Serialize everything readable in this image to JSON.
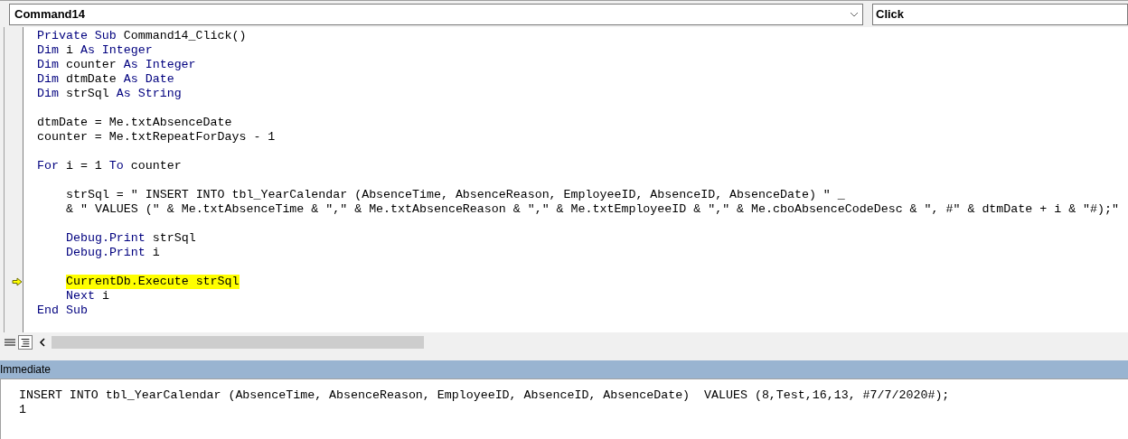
{
  "object_dropdown": {
    "value": "Command14"
  },
  "procedure_dropdown": {
    "value": "Click"
  },
  "code": {
    "lines": [
      {
        "kind": "code",
        "current": false,
        "segments": [
          {
            "kind": "keyword",
            "text": "Private Sub"
          },
          {
            "kind": "text",
            "text": " Command14_Click()"
          }
        ]
      },
      {
        "kind": "code",
        "current": false,
        "segments": [
          {
            "kind": "keyword",
            "text": "Dim"
          },
          {
            "kind": "text",
            "text": " i "
          },
          {
            "kind": "keyword",
            "text": "As Integer"
          }
        ]
      },
      {
        "kind": "code",
        "current": false,
        "segments": [
          {
            "kind": "keyword",
            "text": "Dim"
          },
          {
            "kind": "text",
            "text": " counter "
          },
          {
            "kind": "keyword",
            "text": "As Integer"
          }
        ]
      },
      {
        "kind": "code",
        "current": false,
        "segments": [
          {
            "kind": "keyword",
            "text": "Dim"
          },
          {
            "kind": "text",
            "text": " dtmDate "
          },
          {
            "kind": "keyword",
            "text": "As Date"
          }
        ]
      },
      {
        "kind": "code",
        "current": false,
        "segments": [
          {
            "kind": "keyword",
            "text": "Dim"
          },
          {
            "kind": "text",
            "text": " strSql "
          },
          {
            "kind": "keyword",
            "text": "As String"
          }
        ]
      },
      {
        "kind": "blank"
      },
      {
        "kind": "code",
        "current": false,
        "segments": [
          {
            "kind": "text",
            "text": "dtmDate = Me.txtAbsenceDate"
          }
        ]
      },
      {
        "kind": "code",
        "current": false,
        "segments": [
          {
            "kind": "text",
            "text": "counter = Me.txtRepeatForDays - 1"
          }
        ]
      },
      {
        "kind": "blank"
      },
      {
        "kind": "code",
        "current": false,
        "segments": [
          {
            "kind": "keyword",
            "text": "For"
          },
          {
            "kind": "text",
            "text": " i = 1 "
          },
          {
            "kind": "keyword",
            "text": "To"
          },
          {
            "kind": "text",
            "text": " counter"
          }
        ]
      },
      {
        "kind": "blank"
      },
      {
        "kind": "code",
        "current": false,
        "segments": [
          {
            "kind": "text",
            "text": "    strSql = \" INSERT INTO tbl_YearCalendar (AbsenceTime, AbsenceReason, EmployeeID, AbsenceID, AbsenceDate) \" _"
          }
        ]
      },
      {
        "kind": "code",
        "current": false,
        "segments": [
          {
            "kind": "text",
            "text": "    & \" VALUES (\" & Me.txtAbsenceTime & \",\" & Me.txtAbsenceReason & \",\" & Me.txtEmployeeID & \",\" & Me.cboAbsenceCodeDesc & \", #\" & dtmDate + i & \"#);\""
          }
        ]
      },
      {
        "kind": "blank"
      },
      {
        "kind": "code",
        "current": false,
        "segments": [
          {
            "kind": "keyword",
            "text": "    Debug.Print"
          },
          {
            "kind": "text",
            "text": " strSql"
          }
        ]
      },
      {
        "kind": "code",
        "current": false,
        "segments": [
          {
            "kind": "keyword",
            "text": "    Debug.Print"
          },
          {
            "kind": "text",
            "text": " i"
          }
        ]
      },
      {
        "kind": "blank"
      },
      {
        "kind": "code",
        "current": true,
        "segments": [
          {
            "kind": "text",
            "text": "    CurrentDb.Execute strSql"
          }
        ]
      },
      {
        "kind": "code",
        "current": false,
        "segments": [
          {
            "kind": "keyword",
            "text": "    Next"
          },
          {
            "kind": "text",
            "text": " i"
          }
        ]
      },
      {
        "kind": "code",
        "current": false,
        "segments": [
          {
            "kind": "keyword",
            "text": "End Sub"
          }
        ]
      }
    ]
  },
  "immediate": {
    "title": "Immediate",
    "lines": [
      "INSERT INTO tbl_YearCalendar (AbsenceTime, AbsenceReason, EmployeeID, AbsenceID, AbsenceDate)  VALUES (8,Test,16,13, #7/7/2020#);",
      "1"
    ]
  }
}
